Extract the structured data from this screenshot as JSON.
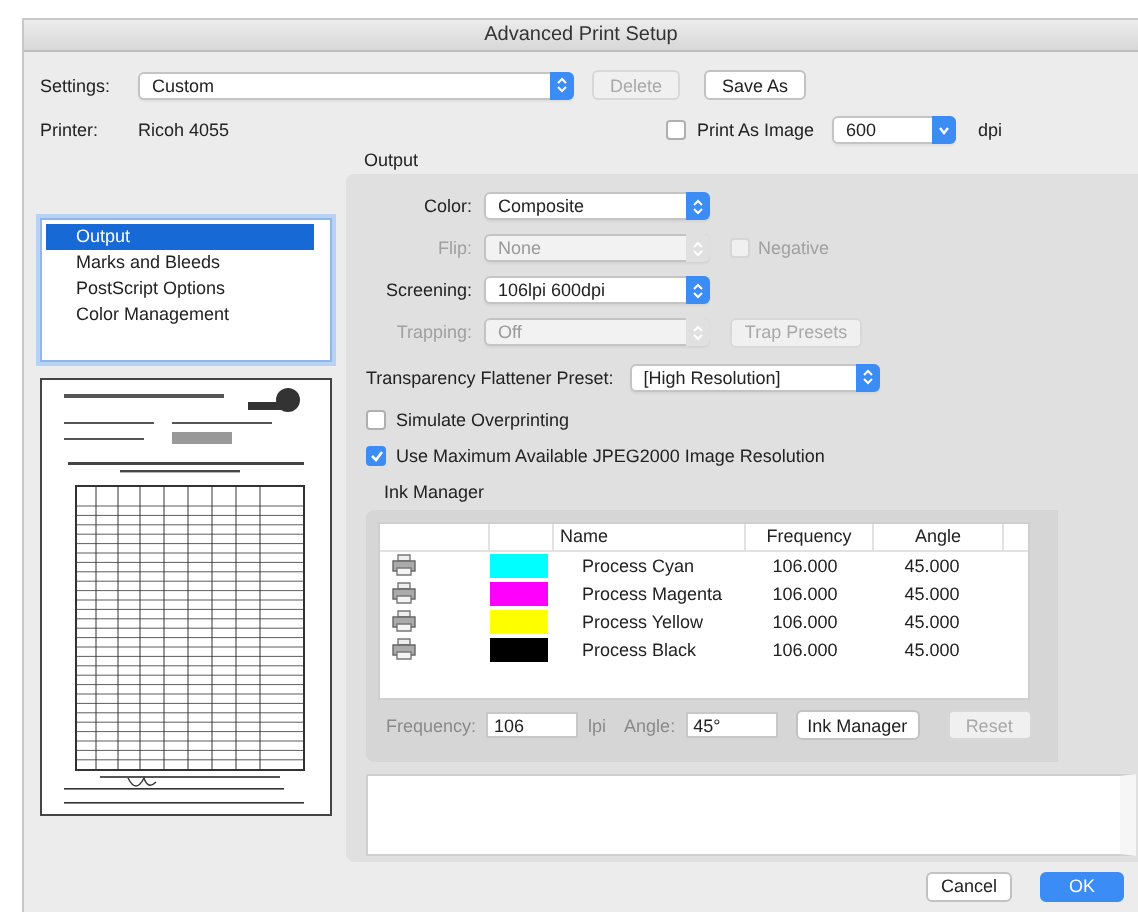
{
  "window": {
    "title": "Advanced Print Setup"
  },
  "settings": {
    "label": "Settings:",
    "value": "Custom"
  },
  "top_buttons": [
    {
      "label": "Delete",
      "disabled": true
    },
    {
      "label": "Save As",
      "disabled": false
    }
  ],
  "printer": {
    "label": "Printer:",
    "value": "Ricoh 4055"
  },
  "print_as_image": {
    "label": "Print As Image",
    "checked": false
  },
  "resolution": {
    "kind": "combo",
    "value": "600",
    "unit": "dpi"
  },
  "sidebar": {
    "items": [
      {
        "label": "Output",
        "selected": true
      },
      {
        "label": "Marks and Bleeds",
        "selected": false
      },
      {
        "label": "PostScript Options",
        "selected": false
      },
      {
        "label": "Color Management",
        "selected": false
      }
    ]
  },
  "output": {
    "title": "Output",
    "fields": [
      {
        "label": "Color:",
        "value": "Composite",
        "disabled": false
      },
      {
        "label": "Flip:",
        "value": "None",
        "disabled": true,
        "extra": {
          "kind": "checkbox",
          "label": "Negative",
          "checked": false,
          "disabled": true
        }
      },
      {
        "label": "Screening:",
        "value": "106lpi 600dpi",
        "disabled": false
      },
      {
        "label": "Trapping:",
        "value": "Off",
        "disabled": true,
        "extra": {
          "kind": "button",
          "label": "Trap Presets",
          "disabled": true
        }
      }
    ],
    "flattener": {
      "label": "Transparency Flattener Preset:",
      "value": "[High Resolution]"
    },
    "options": [
      {
        "label": "Simulate Overprinting",
        "checked": false
      },
      {
        "label": "Use Maximum Available JPEG2000 Image Resolution",
        "checked": true
      }
    ]
  },
  "ink_manager": {
    "title": "Ink Manager",
    "columns": [
      "Name",
      "Frequency",
      "Angle"
    ],
    "rows": [
      {
        "name": "Process Cyan",
        "color": "#00ffff",
        "frequency": "106.000",
        "angle": "45.000"
      },
      {
        "name": "Process Magenta",
        "color": "#ff00ff",
        "frequency": "106.000",
        "angle": "45.000"
      },
      {
        "name": "Process Yellow",
        "color": "#ffff00",
        "frequency": "106.000",
        "angle": "45.000"
      },
      {
        "name": "Process Black",
        "color": "#000000",
        "frequency": "106.000",
        "angle": "45.000"
      }
    ],
    "frequency": {
      "label": "Frequency:",
      "value": "106",
      "unit": "lpi"
    },
    "angle": {
      "label": "Angle:",
      "value": "45°"
    },
    "buttons": [
      {
        "label": "Ink Manager",
        "disabled": false
      },
      {
        "label": "Reset",
        "disabled": true
      }
    ]
  },
  "footer_buttons": [
    {
      "label": "Cancel",
      "default": false
    },
    {
      "label": "OK",
      "default": true
    }
  ]
}
